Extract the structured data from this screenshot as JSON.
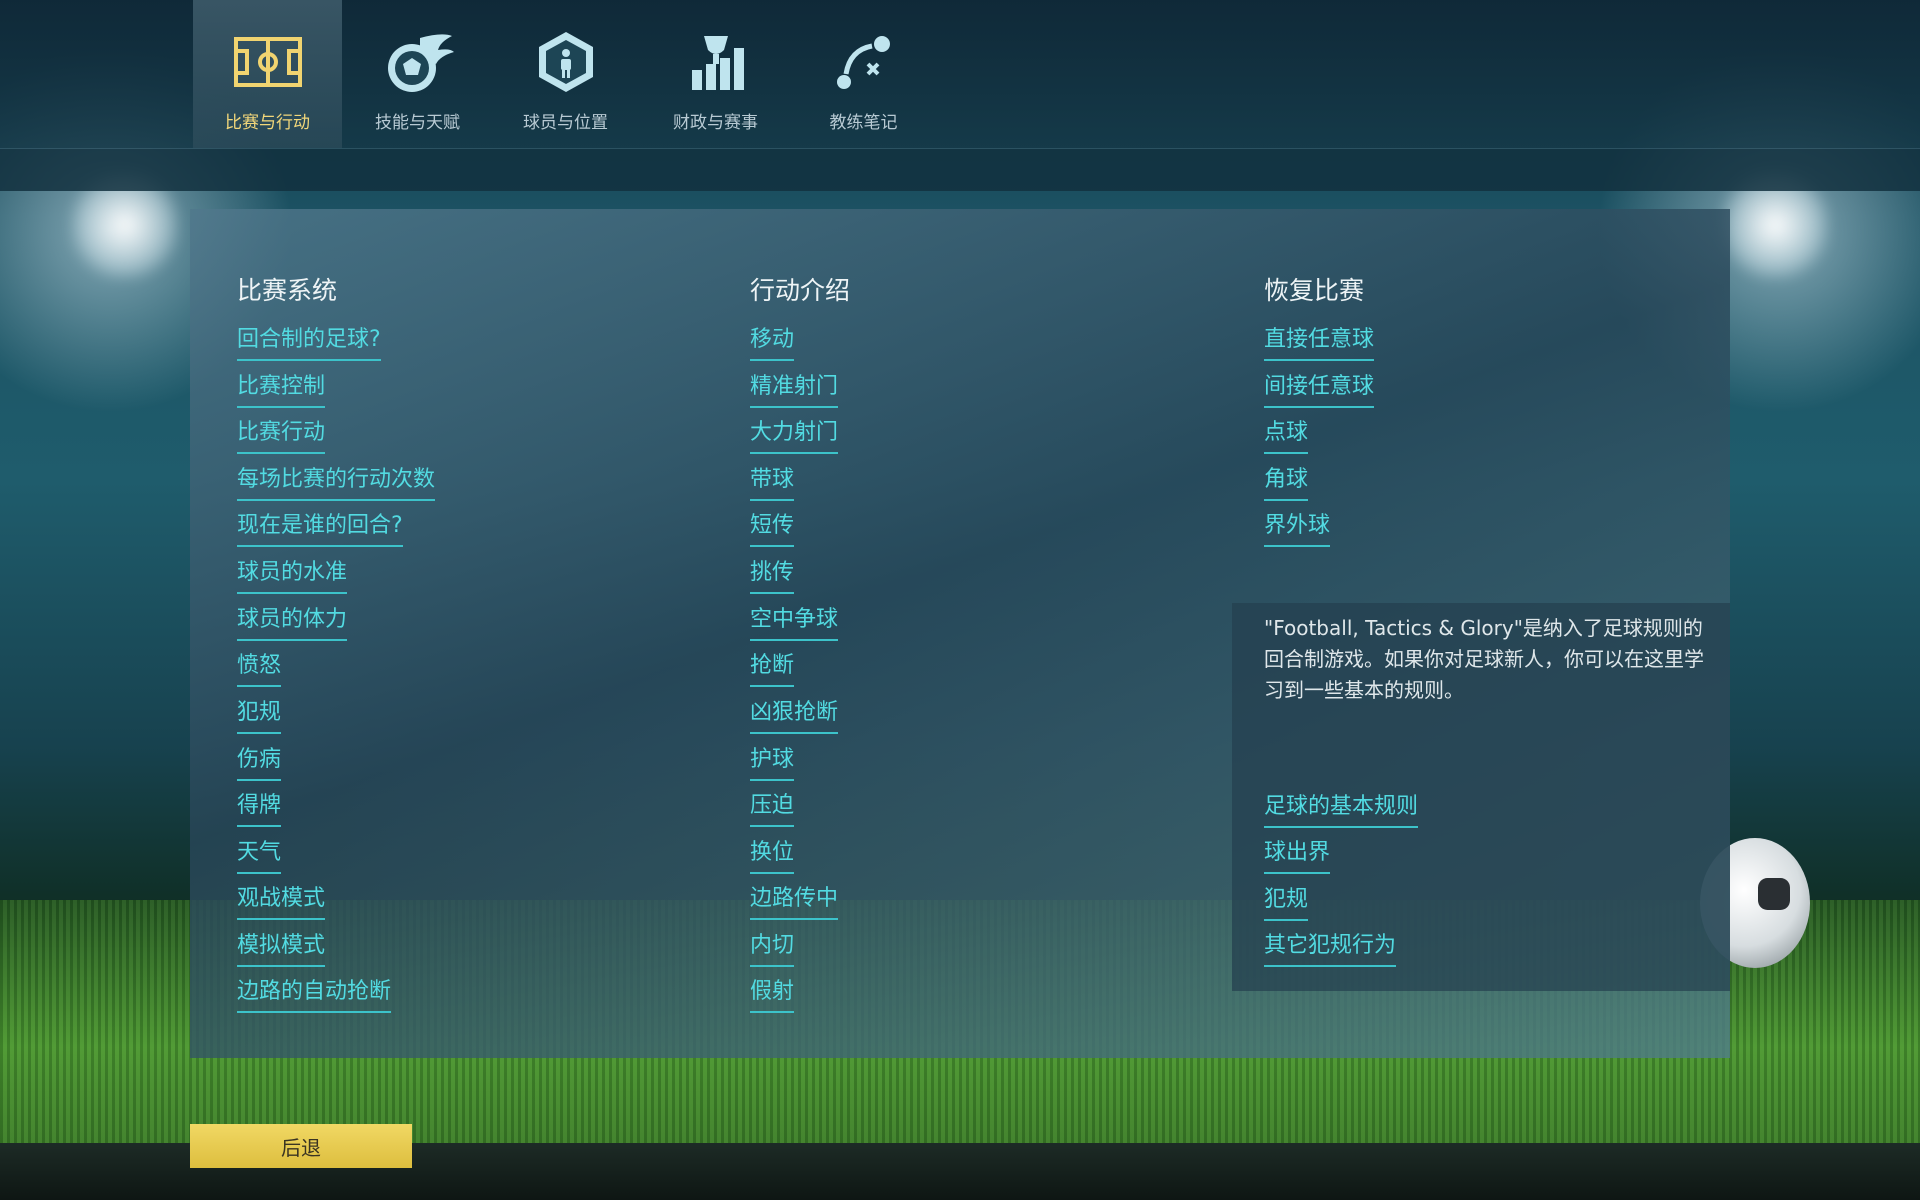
{
  "nav": {
    "tabs": [
      {
        "label": "比赛与行动",
        "icon": "pitch-icon",
        "active": true
      },
      {
        "label": "技能与天赋",
        "icon": "fireball-icon",
        "active": false
      },
      {
        "label": "球员与位置",
        "icon": "player-badge-icon",
        "active": false
      },
      {
        "label": "财政与赛事",
        "icon": "trophy-chart-icon",
        "active": false
      },
      {
        "label": "教练笔记",
        "icon": "tactics-icon",
        "active": false
      }
    ]
  },
  "columns": [
    {
      "title": "比赛系统",
      "links": [
        "回合制的足球?",
        "比赛控制",
        "比赛行动",
        "每场比赛的行动次数",
        "现在是谁的回合?",
        "球员的水准",
        "球员的体力",
        "愤怒",
        "犯规",
        "伤病",
        "得牌",
        "天气",
        "观战模式",
        "模拟模式",
        "边路的自动抢断"
      ]
    },
    {
      "title": "行动介绍",
      "links": [
        "移动",
        "精准射门",
        "大力射门",
        "带球",
        "短传",
        "挑传",
        "空中争球",
        "抢断",
        "凶狠抢断",
        "护球",
        "压迫",
        "换位",
        "边路传中",
        "内切",
        "假射"
      ]
    },
    {
      "title": "恢复比赛",
      "links": [
        "直接任意球",
        "间接任意球",
        "点球",
        "角球",
        "界外球"
      ]
    }
  ],
  "info": {
    "text": "\"Football, Tactics & Glory\"是纳入了足球规则的回合制游戏。如果你对足球新人，你可以在这里学习到一些基本的规则。",
    "links": [
      "足球的基本规则",
      "球出界",
      "犯规",
      "其它犯规行为"
    ]
  },
  "back_button": "后退",
  "colors": {
    "link": "#52dbe2",
    "active_tab": "#f2d77a",
    "back_button": "#e9cc52"
  }
}
